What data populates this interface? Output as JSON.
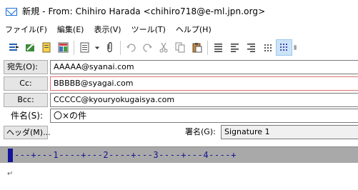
{
  "window": {
    "title": "新規 - From: Chihiro Harada <chihiro718@e-ml.jpn.org>"
  },
  "menu": [
    {
      "label": "ファイル(F)"
    },
    {
      "label": "編集(E)"
    },
    {
      "label": "表示(V)"
    },
    {
      "label": "ツール(T)"
    },
    {
      "label": "ヘルプ(H)"
    }
  ],
  "toolbar": {
    "icons": [
      "send-icon",
      "sign-icon",
      "address-book-icon",
      "template-icon",
      "format-icon",
      "dropdown-icon",
      "attach-icon",
      "undo-icon",
      "redo-icon",
      "cut-icon",
      "copy-icon",
      "paste-icon",
      "align-justify-icon",
      "align-left-icon",
      "align-right-icon",
      "grid-small-icon",
      "grid-large-icon",
      "next-icon"
    ]
  },
  "headers": {
    "to": {
      "label": "宛先(O):",
      "value": "AAAAA@syanai.com"
    },
    "cc": {
      "label": "Cc:",
      "value": "BBBBB@syagai.com"
    },
    "bcc": {
      "label": "Bcc:",
      "value": "CCCCC@kyouryokugaisya.com"
    },
    "subject": {
      "label": "件名(S):",
      "value": "〇×の件"
    },
    "header_button": "ヘッダ(M)...",
    "signature_label": "署名(G):",
    "signature_value": "Signature 1"
  },
  "ruler": {
    "text": "---+---1----+---2----+---3----+---4----+"
  },
  "body": {
    "return_mark": "↵"
  },
  "colors": {
    "ruler_bg": "#a9a9a9",
    "ruler_text": "#15158f",
    "cc_border": "#e07070"
  }
}
